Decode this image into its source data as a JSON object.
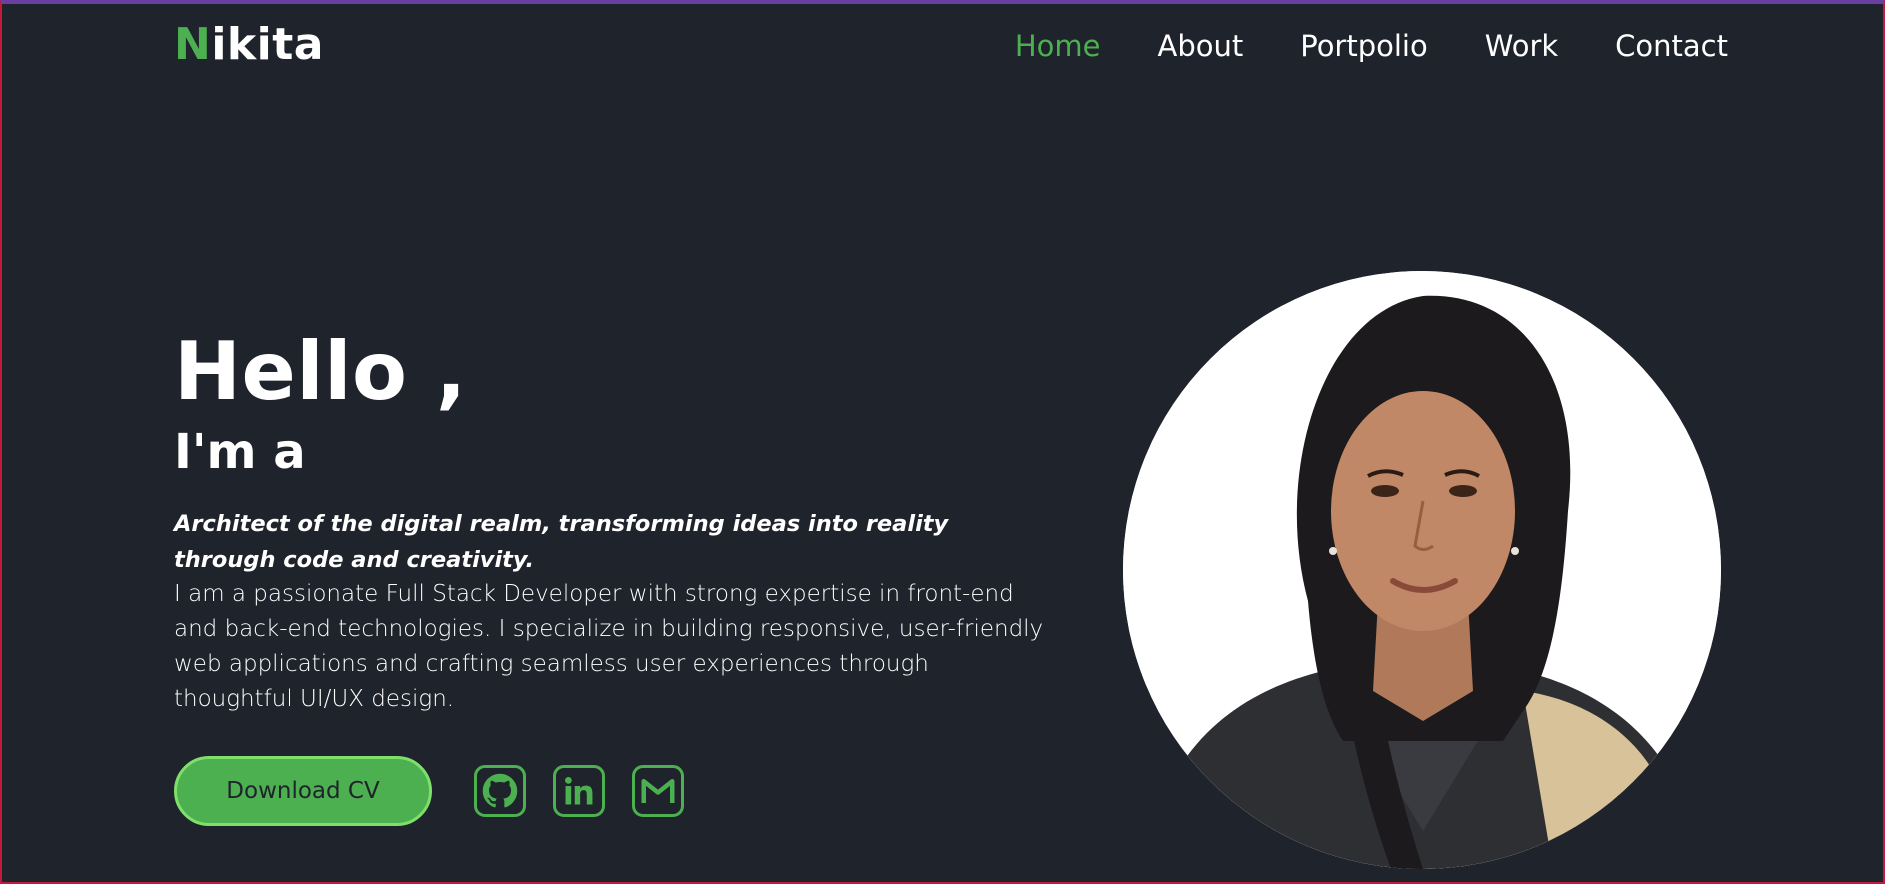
{
  "brand": {
    "first_letter": "N",
    "rest": "ikita"
  },
  "nav": {
    "items": [
      {
        "label": "Home",
        "active": true
      },
      {
        "label": "About",
        "active": false
      },
      {
        "label": "Portpolio",
        "active": false
      },
      {
        "label": "Work",
        "active": false
      },
      {
        "label": "Contact",
        "active": false
      }
    ]
  },
  "hero": {
    "title": "Hello ,",
    "subtitle": "I'm a",
    "tagline": "Architect of the digital realm, transforming ideas into reality through code and creativity.",
    "bio": "I am a passionate Full Stack Developer with strong expertise in front-end and back-end technologies. I specialize in building responsive, user-friendly web applications and crafting seamless user experiences through thoughtful UI/UX design.",
    "cv_button": "Download CV"
  },
  "social": [
    {
      "icon": "github-icon"
    },
    {
      "icon": "linkedin-icon"
    },
    {
      "icon": "gmail-icon"
    }
  ],
  "colors": {
    "background": "#1f232b",
    "accent": "#4caf50",
    "text": "#ffffff"
  }
}
